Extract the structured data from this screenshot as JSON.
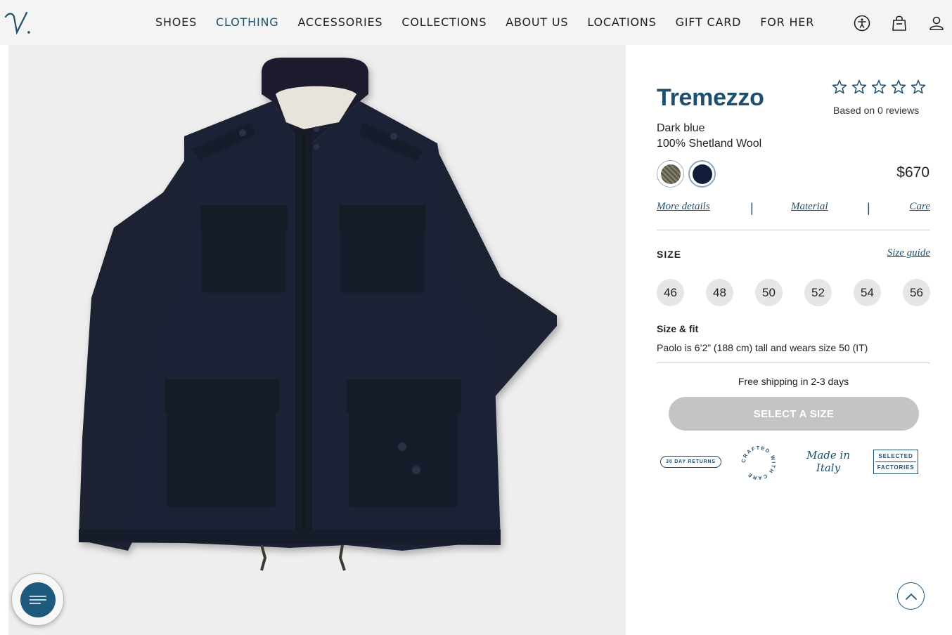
{
  "header": {
    "logo_text": "V.",
    "nav": [
      {
        "label": "SHOES",
        "active": false
      },
      {
        "label": "CLOTHING",
        "active": true
      },
      {
        "label": "ACCESSORIES",
        "active": false
      },
      {
        "label": "COLLECTIONS",
        "active": false
      },
      {
        "label": "ABOUT US",
        "active": false
      },
      {
        "label": "LOCATIONS",
        "active": false
      },
      {
        "label": "GIFT CARD",
        "active": false
      },
      {
        "label": "FOR HER",
        "active": false
      }
    ],
    "icons": [
      "accessibility-icon",
      "shopping-bag-icon",
      "account-icon"
    ]
  },
  "product": {
    "title": "Tremezzo",
    "rating": {
      "stars": 0,
      "max": 5,
      "reviews_text": "Based on 0 reviews"
    },
    "color_name": "Dark blue",
    "material": "100% Shetland Wool",
    "swatches": [
      {
        "name": "green-check",
        "color": "#5d5a48",
        "selected": false
      },
      {
        "name": "dark-blue",
        "color": "#141c3b",
        "selected": true
      }
    ],
    "price": "$670",
    "links": {
      "more_details": "More details",
      "material": "Material",
      "care": "Care",
      "separator": "|"
    },
    "size_label": "SIZE",
    "size_guide": "Size guide",
    "sizes": [
      "46",
      "48",
      "50",
      "52",
      "54",
      "56"
    ],
    "fit_label": "Size & fit",
    "fit_text": "Paolo is 6’2” (188 cm) tall and wears size 50 (IT)",
    "shipping": "Free shipping in 2-3 days",
    "cta": "SELECT A SIZE",
    "badges": {
      "returns": "30 DAY RETURNS",
      "crafted": "CRAFTED WITH CARE",
      "italy_line1": "Made in",
      "italy_line2": "Italy",
      "factories_line1": "SELECTED",
      "factories_line2": "FACTORIES"
    }
  },
  "colors": {
    "accent": "#1d4f6e",
    "cta_disabled": "#c4c4c4",
    "image_bg": "#eeeeee",
    "jacket": "#1c2233"
  }
}
